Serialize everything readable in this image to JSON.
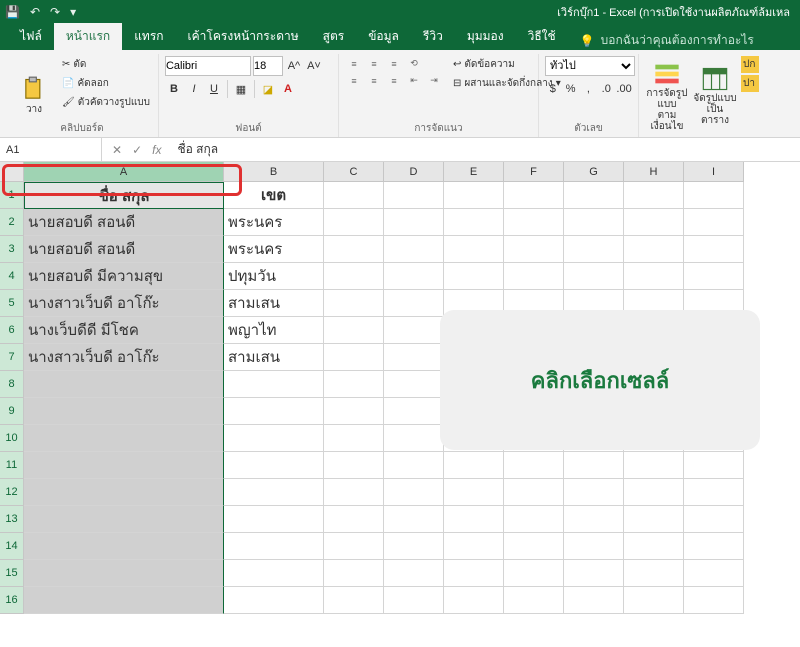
{
  "title": "เวิร์กบุ๊ก1 - Excel (การเปิดใช้งานผลิตภัณฑ์ล้มเหล",
  "tabs": [
    "ไฟล์",
    "หน้าแรก",
    "แทรก",
    "เค้าโครงหน้ากระดาษ",
    "สูตร",
    "ข้อมูล",
    "รีวิว",
    "มุมมอง",
    "วิธีใช้"
  ],
  "tell_me": "บอกฉันว่าคุณต้องการทำอะไร",
  "clipboard": {
    "paste": "วาง",
    "cut": "ตัด",
    "copy": "คัดลอก",
    "painter": "ตัวคัดวางรูปแบบ",
    "label": "คลิปบอร์ด"
  },
  "font": {
    "name": "Calibri",
    "size": "18",
    "label": "ฟอนต์"
  },
  "alignment": {
    "wrap": "ตัดข้อความ",
    "merge": "ผสานและจัดกึ่งกลาง",
    "label": "การจัดแนว"
  },
  "number": {
    "format": "ทั่วไป",
    "label": "ตัวเลข"
  },
  "styles": {
    "cond": "การจัดรูปแบบ\nตามเงื่อนไข",
    "table": "จัดรูปแบบ\nเป็นตาราง",
    "normal": "ปก",
    "bad": "ปา"
  },
  "namebox": "A1",
  "formula": "ชื่อ สกุล",
  "columns": [
    "A",
    "B",
    "C",
    "D",
    "E",
    "F",
    "G",
    "H",
    "I"
  ],
  "rows": [
    {
      "n": 1,
      "a": "ชื่อ สกุล",
      "b": "เขต",
      "hdr": true
    },
    {
      "n": 2,
      "a": "นายสอบดี สอนดี",
      "b": "พระนคร"
    },
    {
      "n": 3,
      "a": "นายสอบดี สอนดี",
      "b": "พระนคร"
    },
    {
      "n": 4,
      "a": "นายสอบดี มีความสุข",
      "b": "ปทุมวัน"
    },
    {
      "n": 5,
      "a": "นางสาวเว็บดี อาโก๊ะ",
      "b": "สามเสน"
    },
    {
      "n": 6,
      "a": "นางเว็บดีดี มีโชค",
      "b": "พญาไท"
    },
    {
      "n": 7,
      "a": "นางสาวเว็บดี อาโก๊ะ",
      "b": "สามเสน"
    },
    {
      "n": 8
    },
    {
      "n": 9
    },
    {
      "n": 10
    },
    {
      "n": 11
    },
    {
      "n": 12
    },
    {
      "n": 13
    },
    {
      "n": 14
    },
    {
      "n": 15
    },
    {
      "n": 16
    }
  ],
  "callout": "คลิกเลือกเซลล์"
}
